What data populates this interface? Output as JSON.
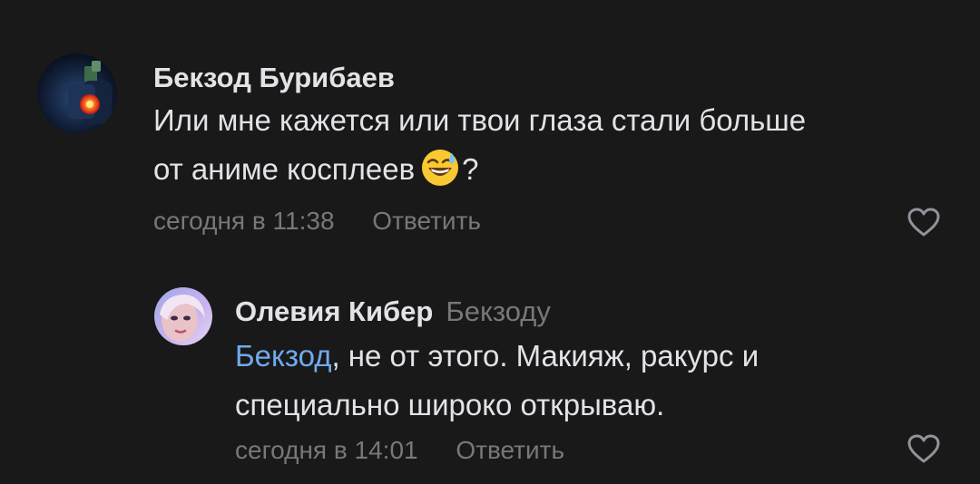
{
  "comments": [
    {
      "author": "Бекзод Бурибаев",
      "text_line1": "Или мне кажется или твои глаза стали больше",
      "text_line2": "от аниме косплеев",
      "emoji": "sweat-smile-emoji",
      "text_after_emoji": "?",
      "time": "сегодня в 11:38",
      "reply_label": "Ответить",
      "like_icon": "heart-outline-icon"
    },
    {
      "author": "Олевия Кибер",
      "reply_to": "Бекзоду",
      "mention": "Бекзод",
      "text_line1_rest": ", не от этого. Макияж, ракурс и",
      "text_line2": "специально широко открываю.",
      "time": "сегодня в 14:01",
      "reply_label": "Ответить",
      "like_icon": "heart-outline-icon"
    }
  ],
  "colors": {
    "background": "#19191a",
    "text_primary": "#e1e3e6",
    "text_secondary": "#76787a",
    "mention": "#71aaeb"
  }
}
